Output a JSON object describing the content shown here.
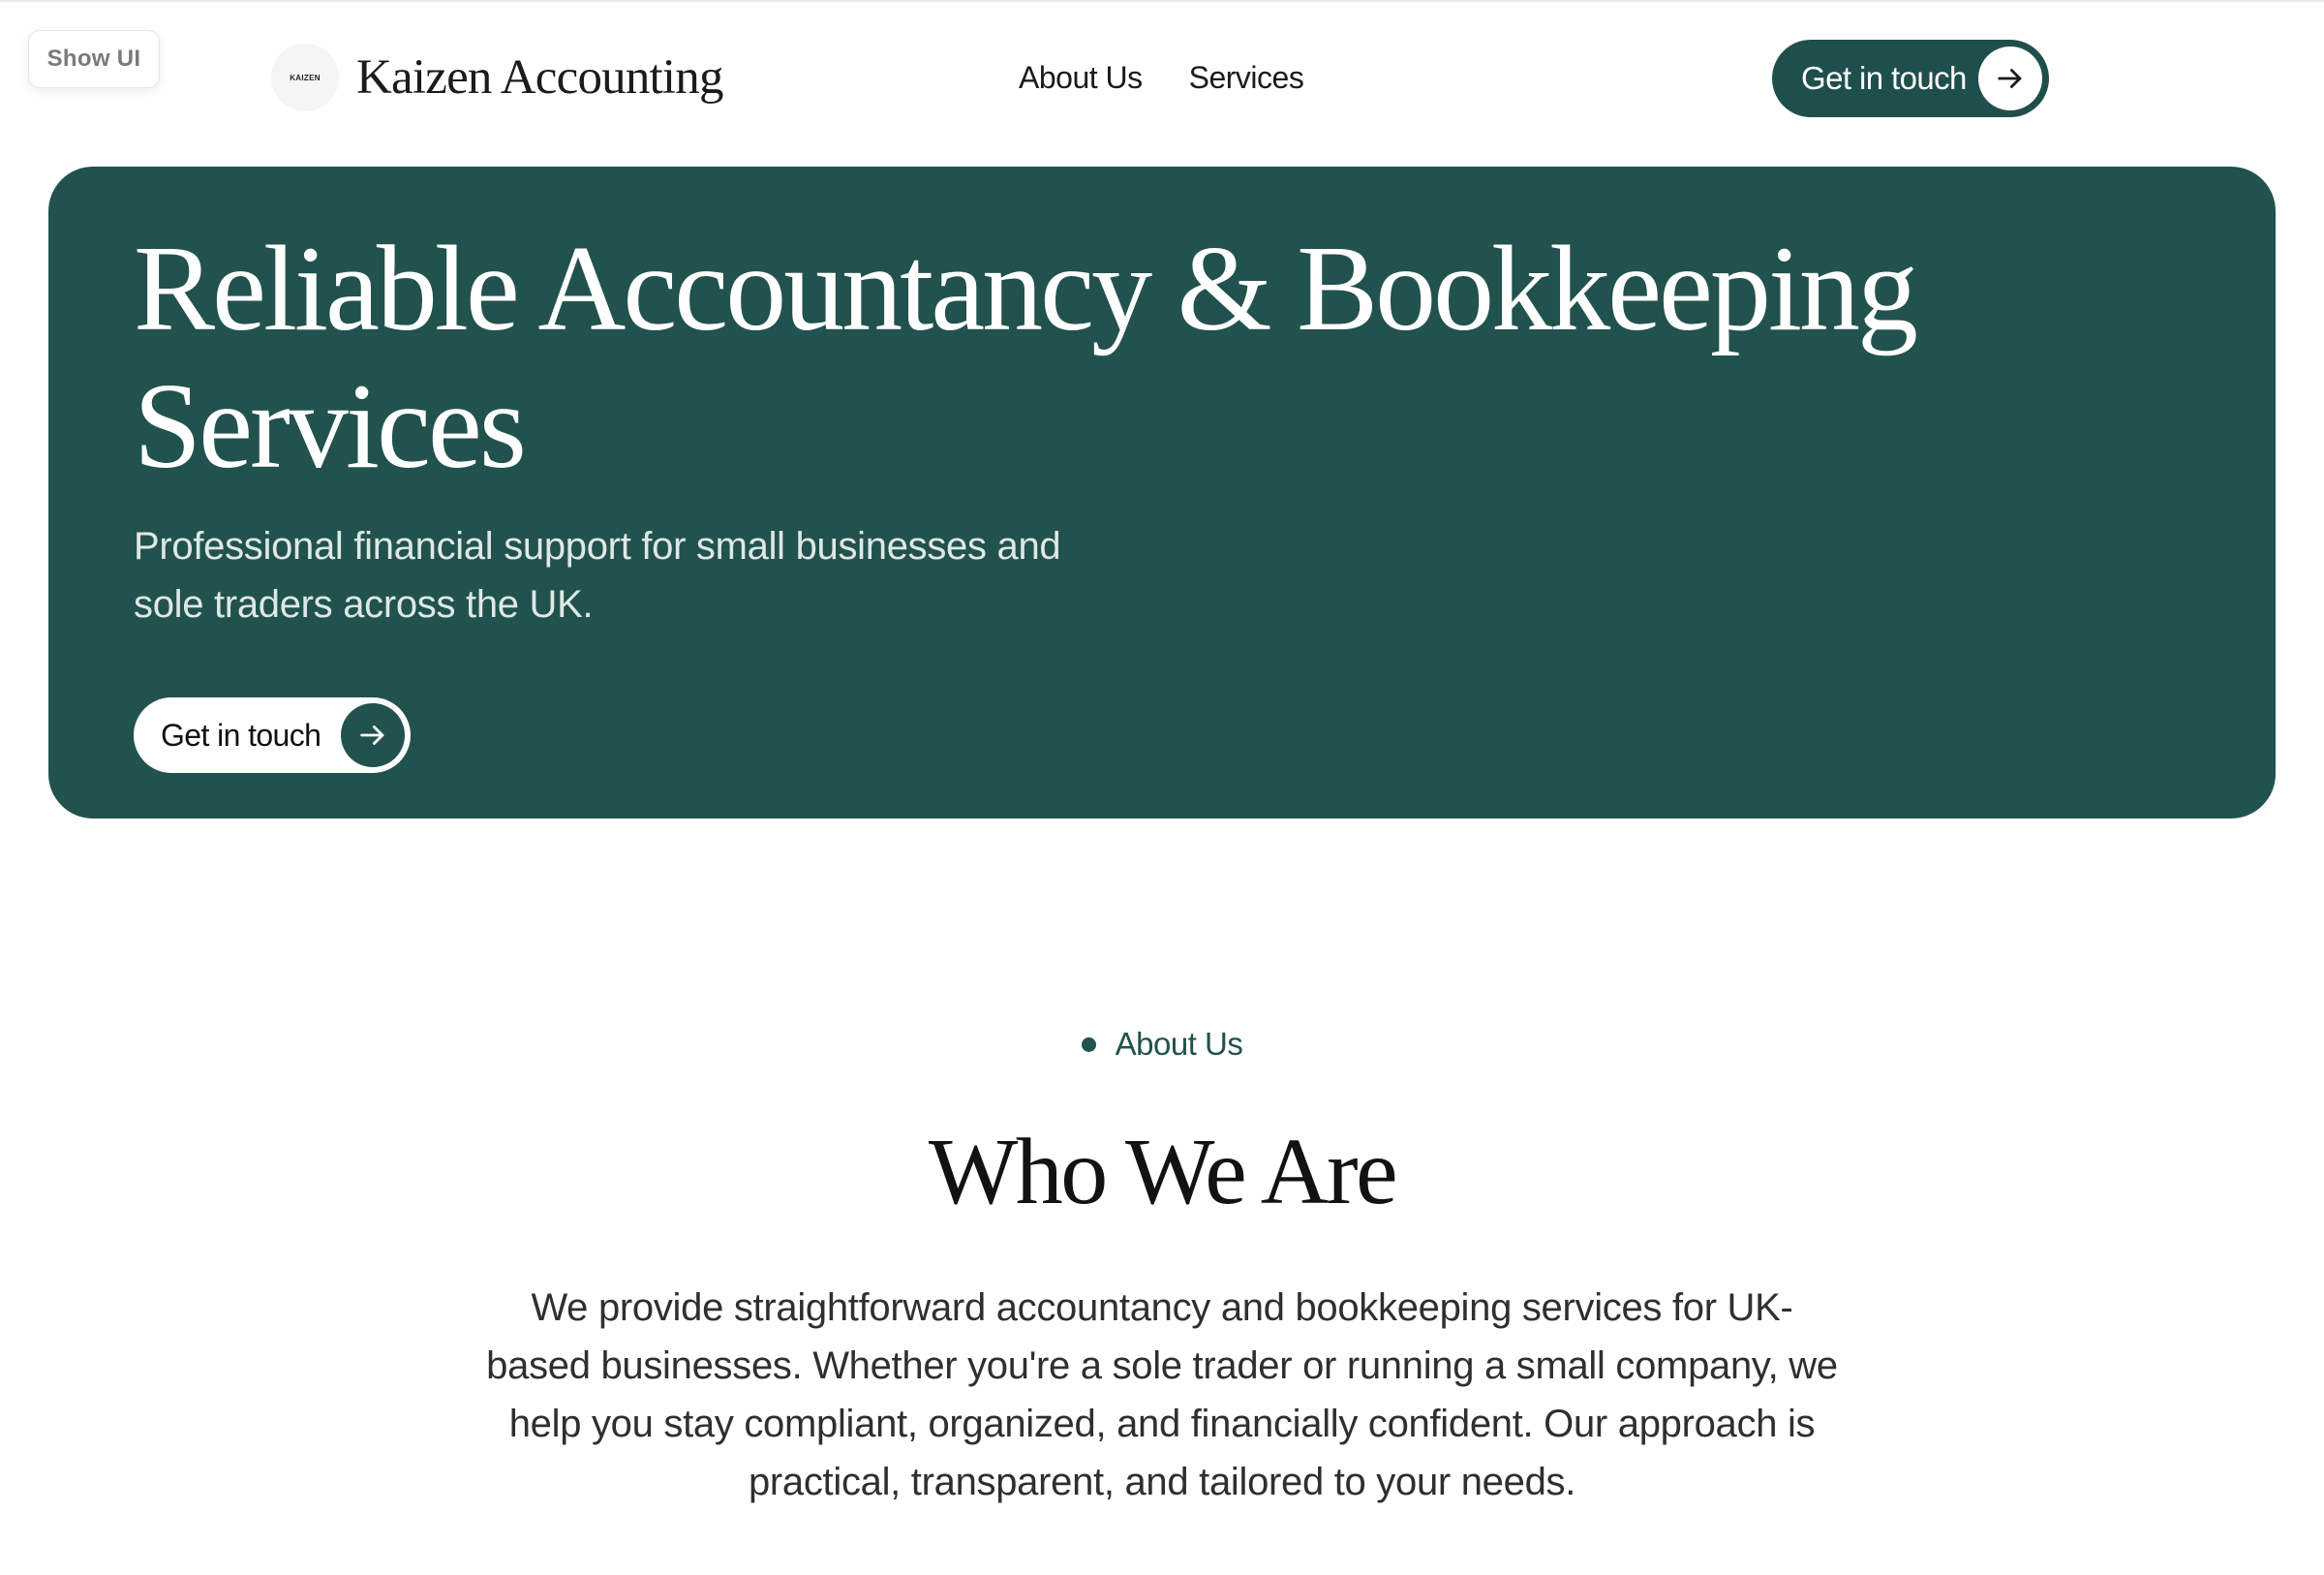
{
  "show_ui": {
    "label": "Show UI"
  },
  "header": {
    "logo_mark": "KAIZEN",
    "brand": "Kaizen Accounting",
    "nav": [
      {
        "label": "About Us"
      },
      {
        "label": "Services"
      }
    ],
    "cta_label": "Get in touch"
  },
  "hero": {
    "title": "Reliable Accountancy & Bookkeeping Services",
    "subtitle": "Professional financial support for small businesses and sole traders across the UK.",
    "cta_label": "Get in touch"
  },
  "about": {
    "tag": "About Us",
    "title": "Who We Are",
    "body": "We provide straightforward accountancy and bookkeeping services for UK-based businesses. Whether you're a sole trader or running a small company, we help you stay compliant, organized, and financially confident. Our approach is practical, transparent, and tailored to your needs."
  },
  "colors": {
    "brand_green": "#21524e",
    "white": "#ffffff",
    "text_dark": "#1b1b1b"
  },
  "icons": {
    "cta_arrow": "arrow-right-icon",
    "tag_bullet": "dot-icon"
  }
}
